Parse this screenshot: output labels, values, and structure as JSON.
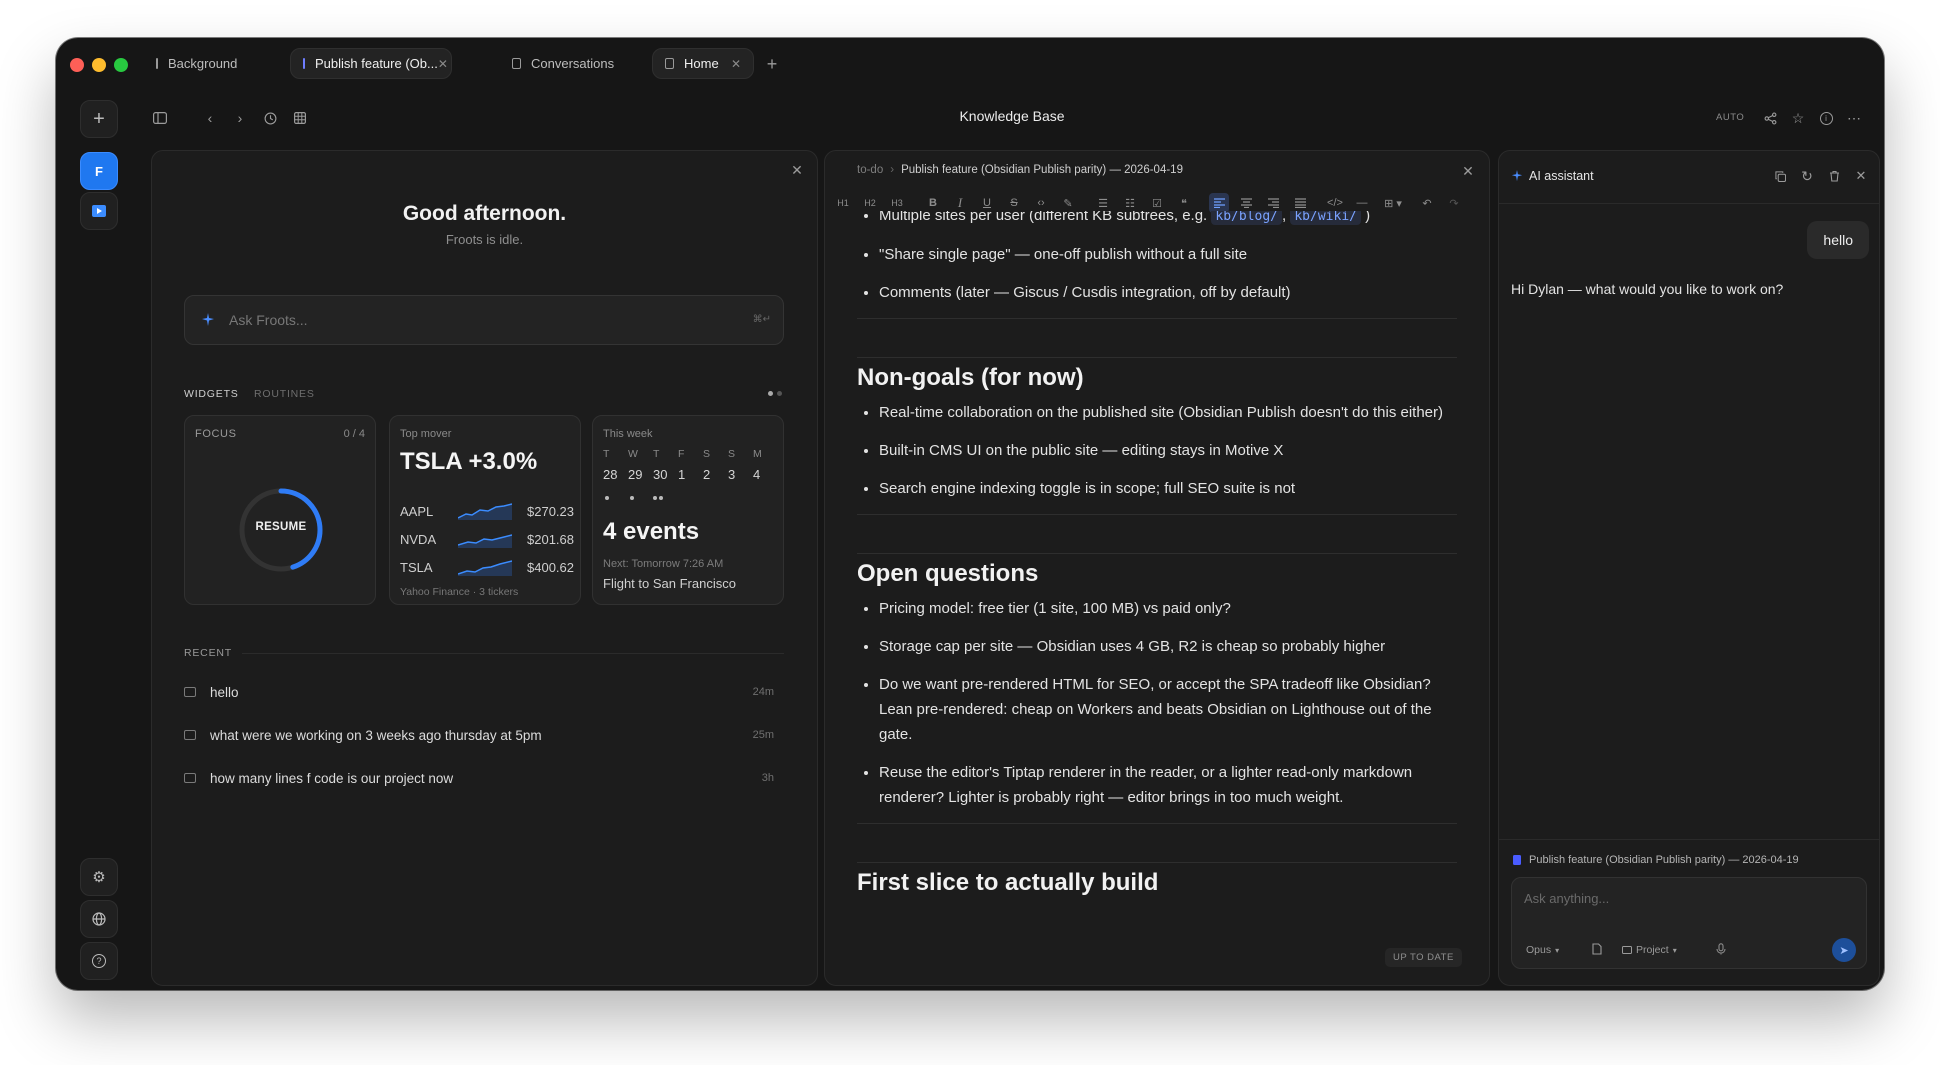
{
  "tabs": [
    {
      "label": "Background"
    },
    {
      "label": "Publish feature (Ob..."
    },
    {
      "label": "Conversations"
    },
    {
      "label": "Home"
    }
  ],
  "toolbar": {
    "title": "Knowledge Base",
    "auto_label": "AUTO"
  },
  "sidebar": {
    "workspace_initial": "F"
  },
  "home": {
    "greeting": "Good afternoon.",
    "status": "Froots is idle.",
    "ask_placeholder": "Ask Froots...",
    "widgets_label": "WIDGETS",
    "routines_label": "ROUTINES",
    "focus": {
      "label": "FOCUS",
      "count": "0 / 4",
      "resume_label": "RESUME",
      "progress": 0.45
    },
    "top_mover": {
      "label": "Top mover",
      "headline": "TSLA +3.0%",
      "tickers": [
        {
          "symbol": "AAPL",
          "price": "$270.23"
        },
        {
          "symbol": "NVDA",
          "price": "$201.68"
        },
        {
          "symbol": "TSLA",
          "price": "$400.62"
        }
      ],
      "source": "Yahoo Finance · 3 tickers"
    },
    "week": {
      "label": "This week",
      "days": [
        "T",
        "W",
        "T",
        "F",
        "S",
        "S",
        "M"
      ],
      "dates": [
        "28",
        "29",
        "30",
        "1",
        "2",
        "3",
        "4"
      ],
      "events_label": "4 events",
      "next_label": "Next: Tomorrow 7:26 AM",
      "next_title": "Flight to San Francisco"
    },
    "recent_label": "RECENT",
    "recent": [
      {
        "title": "hello",
        "time": "24m"
      },
      {
        "title": "what were we working on 3 weeks ago thursday at 5pm",
        "time": "25m"
      },
      {
        "title": "how many lines f code is our project now",
        "time": "3h"
      }
    ]
  },
  "editor": {
    "breadcrumb_root": "to-do",
    "breadcrumb_page": "Publish feature (Obsidian Publish parity) — 2026-04-19",
    "toolbar_headings": [
      "H1",
      "H2",
      "H3"
    ],
    "list1": {
      "item1_text": "Multiple sites per user (different KB subtrees, e.g. ",
      "item1_code1": "kb/blog/",
      "item1_sep": ", ",
      "item1_code2": "kb/wiki/",
      "item1_end": " )",
      "item2": "\"Share single page\" — one-off publish without a full site",
      "item3": "Comments (later — Giscus / Cusdis integration, off by default)"
    },
    "h_nongoals": "Non-goals (for now)",
    "nongoals": [
      "Real-time collaboration on the published site (Obsidian Publish doesn't do this either)",
      "Built-in CMS UI on the public site — editing stays in Motive X",
      "Search engine indexing toggle is in scope; full SEO suite is not"
    ],
    "h_questions": "Open questions",
    "questions": [
      "Pricing model: free tier (1 site, 100 MB) vs paid only?",
      "Storage cap per site — Obsidian uses 4 GB, R2 is cheap so probably higher",
      "Do we want pre-rendered HTML for SEO, or accept the SPA tradeoff like Obsidian? Lean pre-rendered: cheap on Workers and beats Obsidian on Lighthouse out of the gate.",
      "Reuse the editor's Tiptap renderer in the reader, or a lighter read-only markdown renderer? Lighter is probably right — editor brings in too much weight."
    ],
    "h_firstslice": "First slice to actually build",
    "status_badge": "UP TO DATE"
  },
  "assistant": {
    "title": "AI assistant",
    "user_message": "hello",
    "reply": "Hi Dylan — what would you like to work on?",
    "context_doc": "Publish feature (Obsidian Publish parity) — 2026-04-19",
    "input_placeholder": "Ask anything...",
    "model_label": "Opus",
    "project_label": "Project"
  },
  "colors": {
    "accent": "#2f7cf6",
    "window_bg": "#161616",
    "panel_bg": "#1c1c1c"
  }
}
